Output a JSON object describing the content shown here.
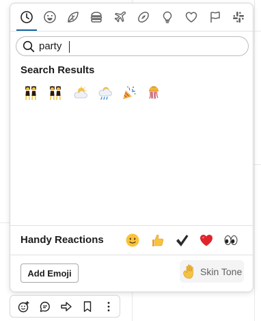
{
  "tabs": [
    {
      "name": "tab-recent",
      "icon": "clock-icon",
      "active": true
    },
    {
      "name": "tab-smileys",
      "icon": "smiley-icon"
    },
    {
      "name": "tab-nature",
      "icon": "leaf-icon"
    },
    {
      "name": "tab-food",
      "icon": "burger-icon"
    },
    {
      "name": "tab-travel",
      "icon": "airplane-icon"
    },
    {
      "name": "tab-activities",
      "icon": "football-icon"
    },
    {
      "name": "tab-objects",
      "icon": "lightbulb-icon"
    },
    {
      "name": "tab-symbols",
      "icon": "heart-icon"
    },
    {
      "name": "tab-flags",
      "icon": "flag-icon"
    },
    {
      "name": "tab-slack",
      "icon": "slack-icon"
    }
  ],
  "search": {
    "value": "party",
    "icon": "search-icon"
  },
  "results": {
    "title": "Search Results",
    "emojis": [
      "dancers",
      "dancers",
      "partly-sunny",
      "partly-sunny-rain",
      "tada",
      "confetti-ball"
    ]
  },
  "handy": {
    "label": "Handy Reactions",
    "reactions": [
      "slightly-smiling-face",
      "thumbsup",
      "heavy-check-mark",
      "heart",
      "eyes"
    ]
  },
  "footer": {
    "add_emoji_label": "Add Emoji",
    "skin_tone_label": "Skin Tone",
    "skin_tone_icon": "raised-hand-icon"
  },
  "message_toolbar": [
    "add-reaction-icon",
    "reply-thread-icon",
    "share-icon",
    "bookmark-icon",
    "more-icon"
  ],
  "colors": {
    "accent": "#1264a3",
    "heart": "#e0242c",
    "skin": "#f5c242"
  }
}
